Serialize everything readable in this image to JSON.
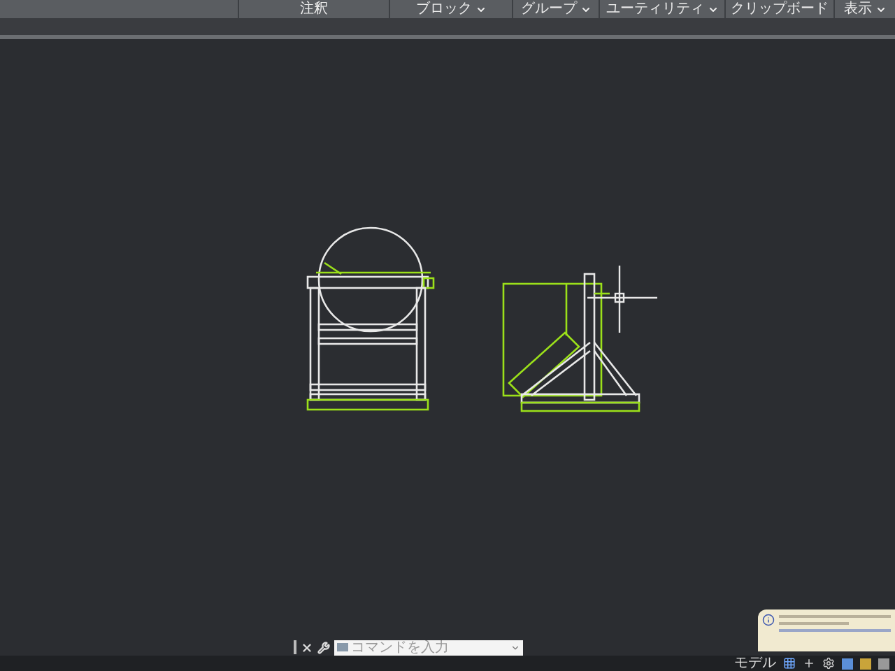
{
  "ribbon_panels": [
    {
      "label": "注釈",
      "has_menu": false
    },
    {
      "label": "ブロック",
      "has_menu": true
    },
    {
      "label": "グループ",
      "has_menu": true
    },
    {
      "label": "ユーティリティ",
      "has_menu": true
    },
    {
      "label": "クリップボード",
      "has_menu": false
    },
    {
      "label": "表示",
      "has_menu": true
    }
  ],
  "command_line": {
    "placeholder": "コマンドを入力"
  },
  "status_bar": {
    "model_label": "モデル"
  }
}
